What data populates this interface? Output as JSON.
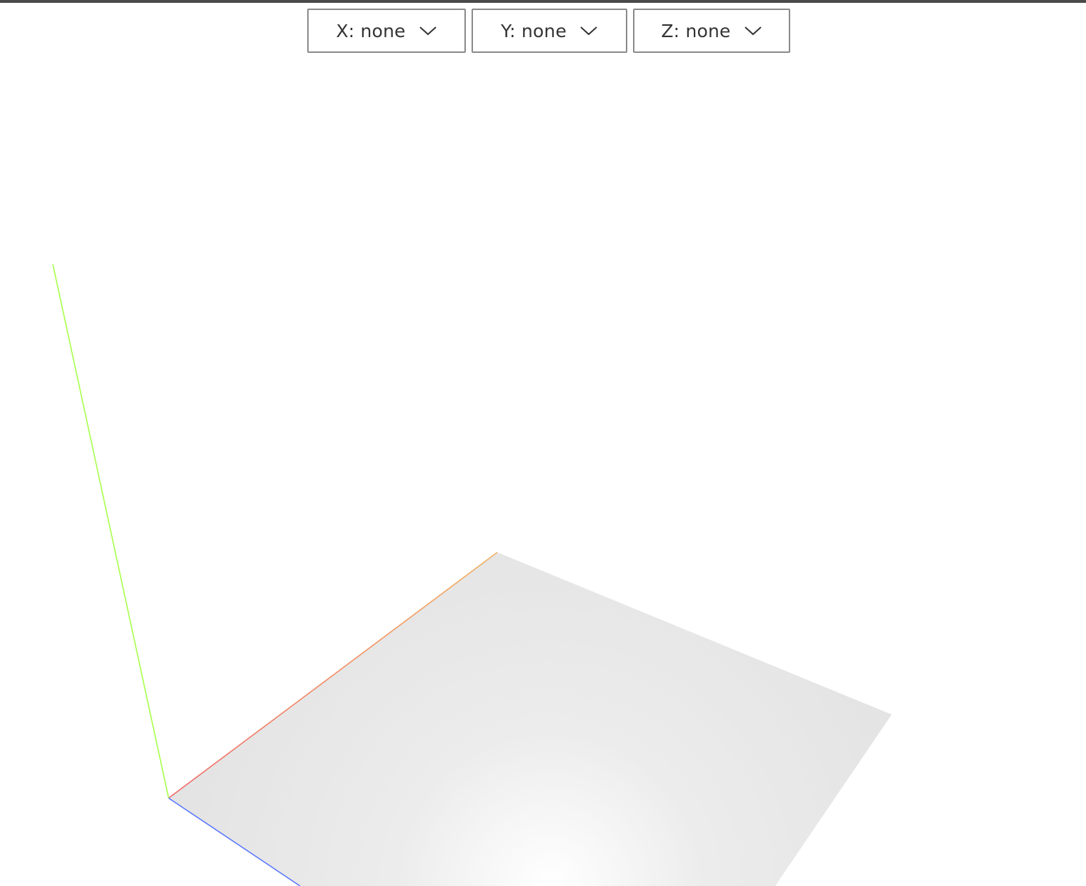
{
  "axis_selectors": {
    "x": {
      "label": "X: none",
      "icon": "chevron-down-icon"
    },
    "y": {
      "label": "Y: none",
      "icon": "chevron-down-icon"
    },
    "z": {
      "label": "Z: none",
      "icon": "chevron-down-icon"
    }
  },
  "scene": {
    "axis_colors": {
      "x": "#f06a6a",
      "y": "#a8ff4a",
      "z": "#5b78ff",
      "x_far": "#f2b060"
    },
    "floor_color": "#e2e2e2",
    "floor_highlight": "#ffffff"
  }
}
